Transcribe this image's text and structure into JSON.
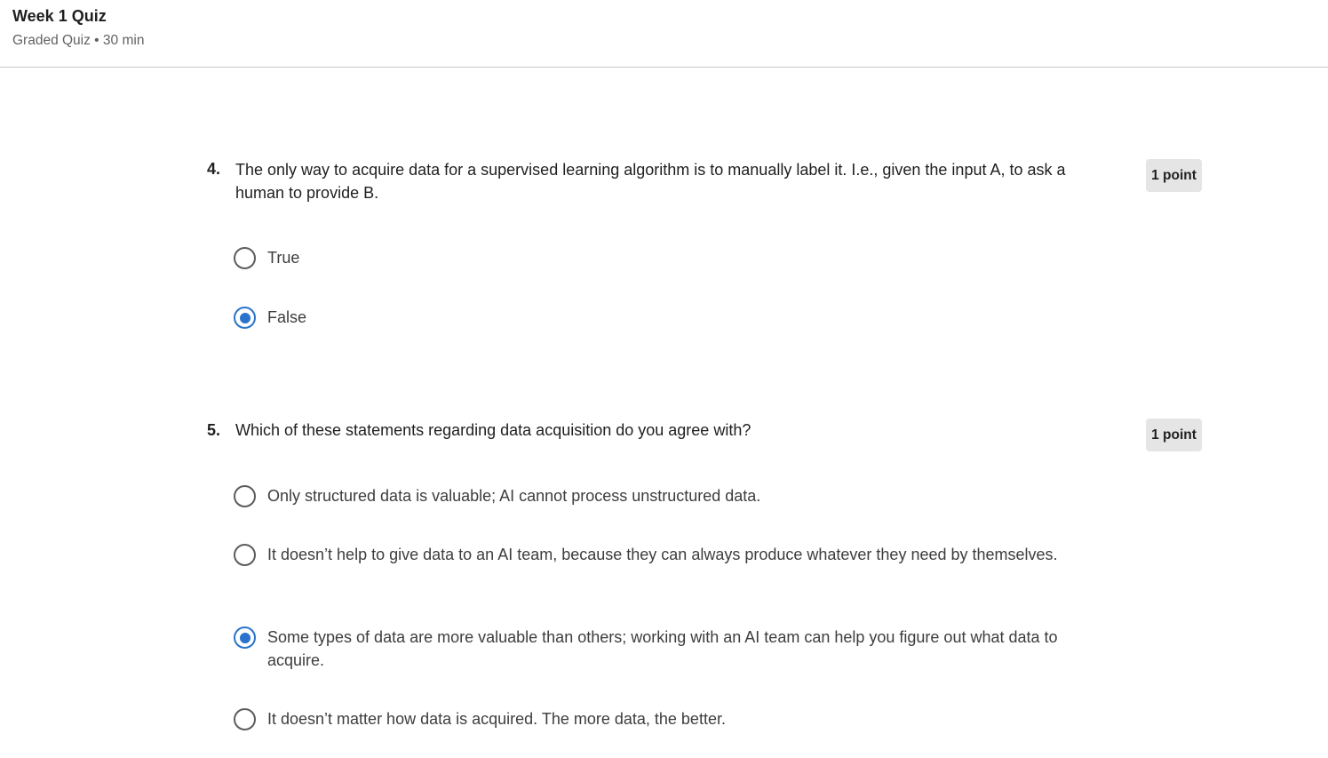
{
  "header": {
    "title": "Week 1 Quiz",
    "meta": "Graded Quiz • 30 min"
  },
  "questions": [
    {
      "number": "4.",
      "text": "The only way to acquire data for a supervised learning algorithm is to manually label it. I.e., given the input A, to ask a human to provide B.",
      "points": "1 point",
      "options": [
        {
          "label": "True",
          "selected": false
        },
        {
          "label": "False",
          "selected": true
        }
      ]
    },
    {
      "number": "5.",
      "text": "Which of these statements regarding data acquisition do you agree with?",
      "points": "1 point",
      "options": [
        {
          "label": "Only structured data is valuable; AI cannot process unstructured data.",
          "selected": false
        },
        {
          "label": "It doesn’t help to give data to an AI team, because they can always produce whatever they need by themselves.",
          "selected": false
        },
        {
          "label": "Some types of data are more valuable than others; working with an AI team can help you figure out what data to acquire.",
          "selected": true
        },
        {
          "label": "It doesn’t matter how data is acquired. The more data, the better.",
          "selected": false
        }
      ]
    }
  ],
  "colors": {
    "accent": "#2a73cc",
    "badge_bg": "#e5e5e5",
    "divider": "#c8c8c8"
  }
}
